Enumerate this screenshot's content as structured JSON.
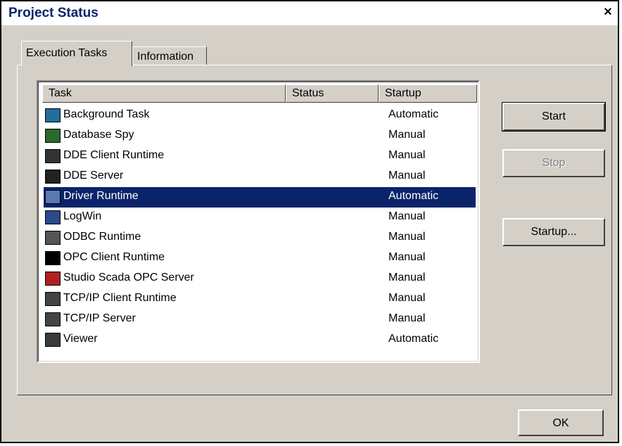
{
  "window": {
    "title": "Project Status",
    "close": "×"
  },
  "tabs": [
    {
      "label": "Execution Tasks",
      "active": true
    },
    {
      "label": "Information",
      "active": false
    }
  ],
  "table": {
    "columns": [
      "Task",
      "Status",
      "Startup"
    ],
    "rows": [
      {
        "icon": "background-task-icon",
        "task": "Background Task",
        "status": "",
        "startup": "Automatic"
      },
      {
        "icon": "database-spy-icon",
        "task": "Database Spy",
        "status": "",
        "startup": "Manual"
      },
      {
        "icon": "dde-client-icon",
        "task": "DDE Client Runtime",
        "status": "",
        "startup": "Manual"
      },
      {
        "icon": "dde-server-icon",
        "task": "DDE Server",
        "status": "",
        "startup": "Manual"
      },
      {
        "icon": "driver-runtime-icon",
        "task": "Driver Runtime",
        "status": "",
        "startup": "Automatic",
        "selected": true
      },
      {
        "icon": "logwin-icon",
        "task": "LogWin",
        "status": "",
        "startup": "Manual"
      },
      {
        "icon": "odbc-icon",
        "task": "ODBC Runtime",
        "status": "",
        "startup": "Manual"
      },
      {
        "icon": "opc-client-icon",
        "task": "OPC Client Runtime",
        "status": "",
        "startup": "Manual"
      },
      {
        "icon": "opc-server-icon",
        "task": "Studio Scada OPC Server",
        "status": "",
        "startup": "Manual"
      },
      {
        "icon": "tcpip-client-icon",
        "task": "TCP/IP Client Runtime",
        "status": "",
        "startup": "Manual"
      },
      {
        "icon": "tcpip-server-icon",
        "task": "TCP/IP Server",
        "status": "",
        "startup": "Manual"
      },
      {
        "icon": "viewer-icon",
        "task": "Viewer",
        "status": "",
        "startup": "Automatic"
      }
    ]
  },
  "buttons": {
    "start": "Start",
    "stop": "Stop",
    "startup": "Startup...",
    "ok": "OK"
  },
  "colors": {
    "selection": "#0a246a",
    "face": "#d4d0c8",
    "title_text": "#0a246a"
  }
}
